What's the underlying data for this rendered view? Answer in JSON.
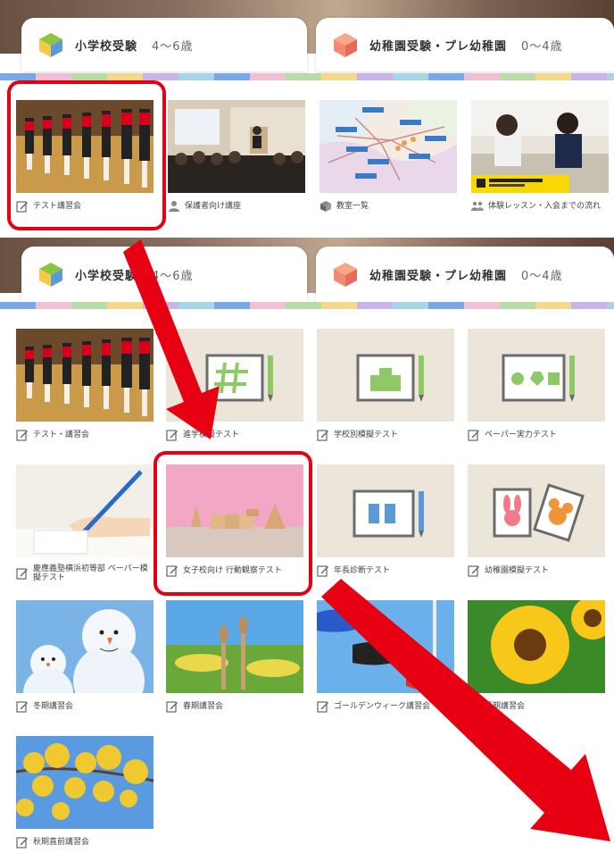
{
  "tabs": {
    "elementary": {
      "label": "小学校受験",
      "age": "4～6歳"
    },
    "kindergarten": {
      "label": "幼稚園受験・プレ幼稚園",
      "age": "0～4歳"
    }
  },
  "before_cards": [
    {
      "label": "テスト講習会",
      "icon": "pencil-icon"
    },
    {
      "label": "保護者向け講座",
      "icon": "person-icon"
    },
    {
      "label": "教室一覧",
      "icon": "box-icon"
    },
    {
      "label": "体験レッスン・入会までの流れ",
      "icon": "people-icon"
    }
  ],
  "after_cards": [
    {
      "label": "テスト・講習会"
    },
    {
      "label": "進学模擬テスト"
    },
    {
      "label": "学校別模擬テスト"
    },
    {
      "label": "ペーパー実力テスト"
    },
    {
      "label": "慶應義塾横浜初等部 ペーパー模擬テスト"
    },
    {
      "label": "女子校向け 行動観察テスト"
    },
    {
      "label": "年長診断テスト"
    },
    {
      "label": "幼稚園模擬テスト"
    },
    {
      "label": "冬期講習会"
    },
    {
      "label": "春期講習会"
    },
    {
      "label": "ゴールデンウィーク講習会"
    },
    {
      "label": "夏期講習会"
    },
    {
      "label": "秋期直前講習会"
    }
  ],
  "colors": {
    "highlight": "#e60012",
    "tile_bg": "#ece6da",
    "icon_line": "#6b6b6b",
    "icon_green": "#8fc866",
    "icon_blue": "#5b9ad6"
  }
}
